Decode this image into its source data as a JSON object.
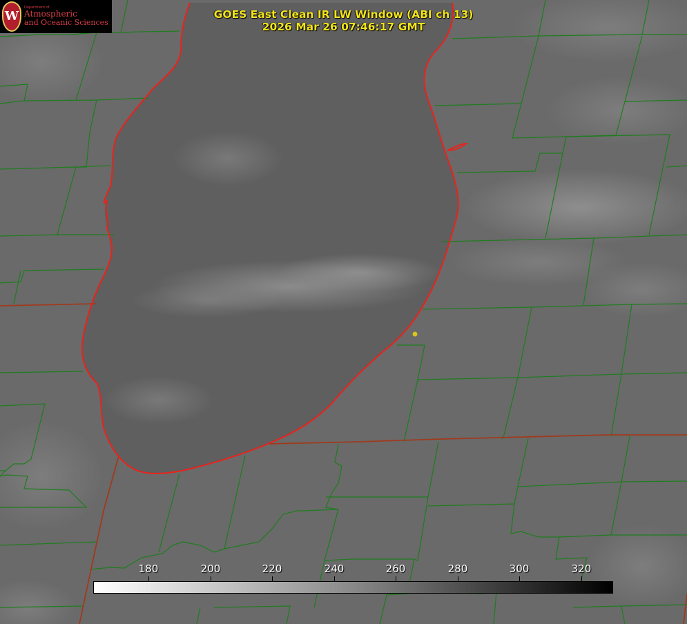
{
  "logo": {
    "department": "Department of",
    "line1": "Atmospheric",
    "line2": "and Oceanic Sciences",
    "seal_letter": "W"
  },
  "title": {
    "line1": "GOES East Clean IR LW Window (ABI ch 13)",
    "line2": "2026 Mar 26 07:46:17 GMT"
  },
  "colorbar": {
    "ticks": [
      "180",
      "200",
      "220",
      "240",
      "260",
      "280",
      "300",
      "320"
    ],
    "color_low": "#ffffff",
    "color_high": "#000000"
  },
  "colors": {
    "background": "#6a6a6a",
    "lake": "#5f5f5f",
    "county_lines": "#1e7d1e",
    "state_lines": "#c0321e",
    "coastline": "#e8231c",
    "marker": "#d8c51e",
    "title_text": "#f2e41b"
  }
}
